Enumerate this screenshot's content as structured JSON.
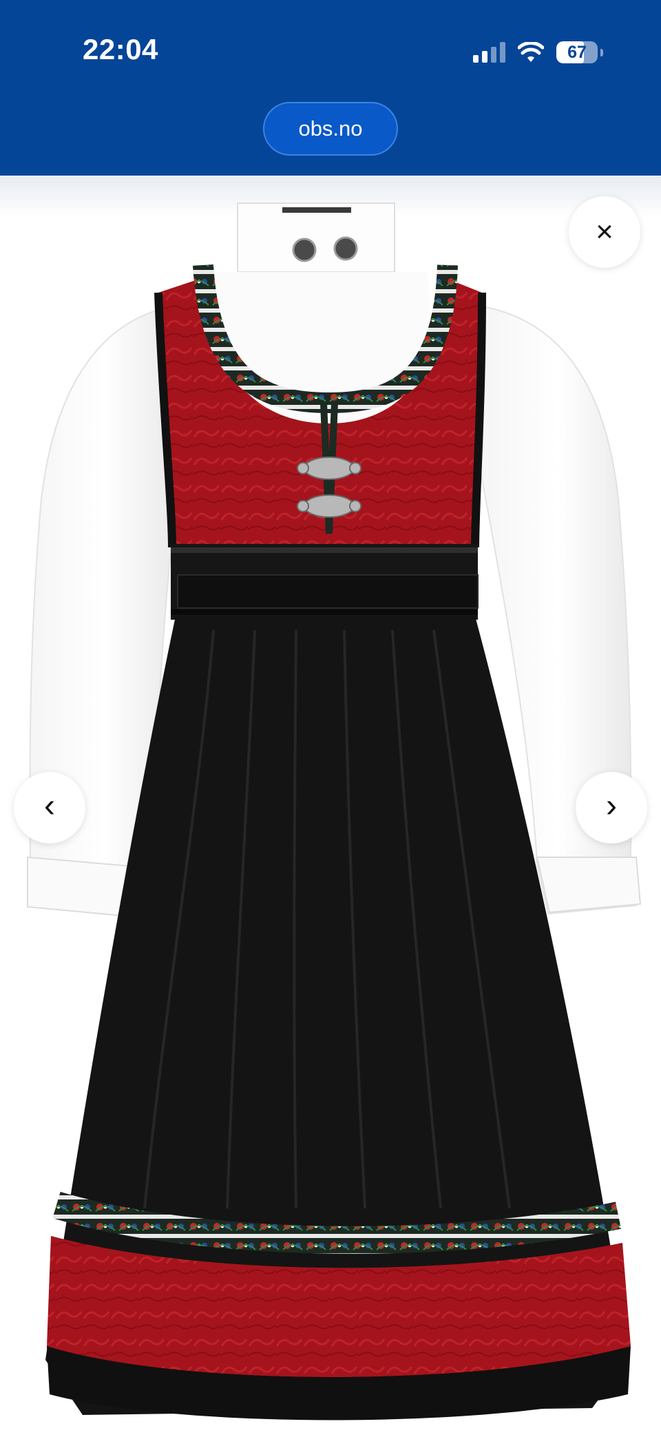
{
  "status_bar": {
    "time": "22:04",
    "battery_level": "67",
    "battery_fraction": 0.67,
    "signal_icon": "cellular-signal-icon",
    "wifi_icon": "wifi-icon"
  },
  "browser": {
    "url": "obs.no"
  },
  "viewer": {
    "close_label": "×",
    "prev_label": "‹",
    "next_label": "›",
    "image_description_icon": "product-photo-bunad-dress"
  },
  "colors": {
    "header_bg": "#054598",
    "dress_red": "#a5141c",
    "dress_black": "#141414"
  }
}
